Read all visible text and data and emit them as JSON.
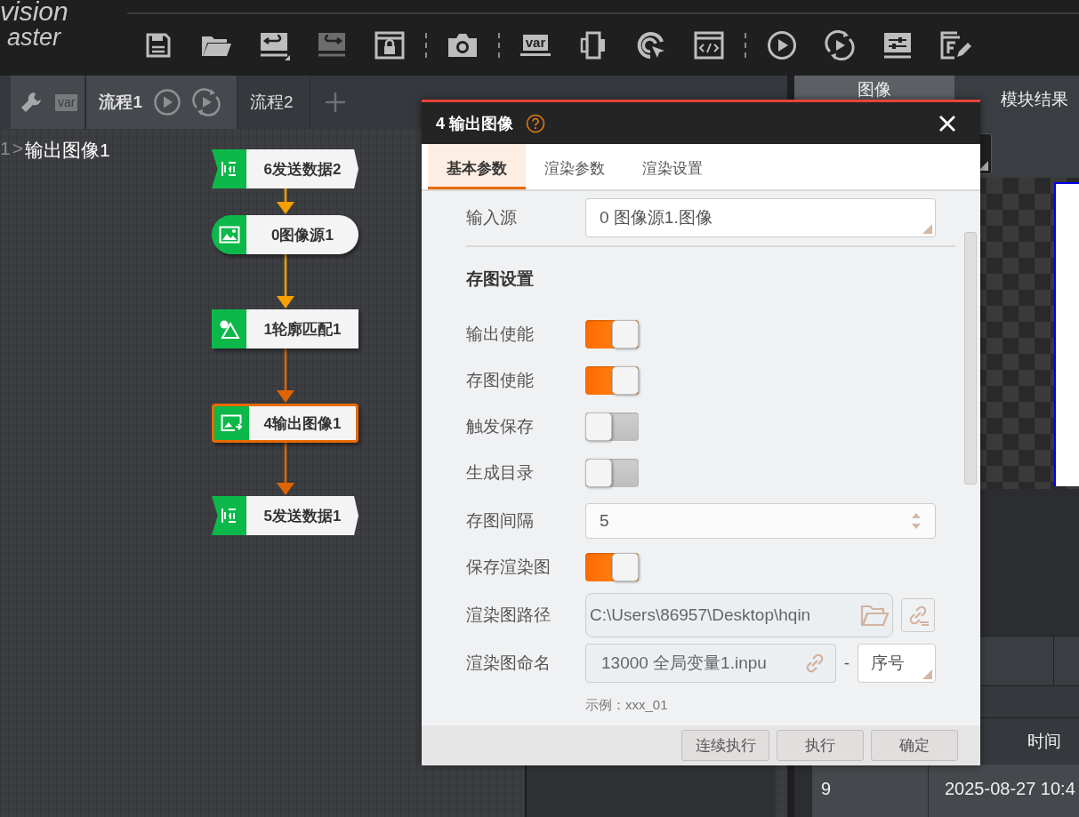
{
  "logo": {
    "line1": "vision",
    "line2": "aster"
  },
  "toolbar_groups": [
    [
      {
        "kind": "save",
        "disabled": false
      },
      {
        "kind": "open",
        "disabled": false
      },
      {
        "kind": "undo",
        "disabled": false
      },
      {
        "kind": "redo",
        "disabled": true
      },
      {
        "kind": "lock",
        "disabled": false
      }
    ],
    [
      {
        "kind": "camera",
        "disabled": false
      }
    ],
    [
      {
        "kind": "variable",
        "disabled": false,
        "text": "var"
      },
      {
        "kind": "device",
        "disabled": false
      },
      {
        "kind": "target",
        "disabled": false
      },
      {
        "kind": "code",
        "disabled": false
      }
    ],
    [
      {
        "kind": "run",
        "disabled": false
      },
      {
        "kind": "loop",
        "disabled": false
      },
      {
        "kind": "sliders",
        "disabled": false
      },
      {
        "kind": "formula",
        "disabled": false
      }
    ]
  ],
  "process_bar": {
    "var_badge": "var",
    "tabs": [
      {
        "label": "流程1",
        "selected": true
      },
      {
        "label": "流程2",
        "selected": false
      }
    ]
  },
  "breadcrumb": {
    "parent": "1",
    "separator": ">",
    "current": "输出图像1"
  },
  "nodes": [
    {
      "label": "6发送数据2",
      "kind": "send",
      "selected": false
    },
    {
      "label": "0图像源1",
      "kind": "source",
      "selected": false
    },
    {
      "label": "1轮廓匹配1",
      "kind": "match",
      "selected": false
    },
    {
      "label": "4输出图像1",
      "kind": "output",
      "selected": true
    },
    {
      "label": "5发送数据1",
      "kind": "send",
      "selected": false
    }
  ],
  "links": [
    {
      "color": "#f5a000"
    },
    {
      "color": "#f5a000"
    },
    {
      "color": "#e06400"
    },
    {
      "color": "#e06400"
    }
  ],
  "right_tabs": [
    {
      "label": "图像",
      "selected": true
    },
    {
      "label": "模块结果",
      "selected": false
    }
  ],
  "results_table": {
    "header": "时间",
    "rows": [
      {
        "index": "9",
        "time": "2025-08-27 10:4"
      }
    ]
  },
  "dialog": {
    "title": "4 输出图像",
    "tabs": [
      {
        "label": "基本参数",
        "selected": true
      },
      {
        "label": "渲染参数",
        "selected": false
      },
      {
        "label": "渲染设置",
        "selected": false
      }
    ],
    "rows": [
      {
        "kind": "select",
        "label": "输入源",
        "value": "0 图像源1.图像"
      },
      {
        "kind": "section",
        "label": "存图设置"
      },
      {
        "kind": "toggle",
        "label": "输出使能",
        "on": true
      },
      {
        "kind": "toggle",
        "label": "存图使能",
        "on": true
      },
      {
        "kind": "toggle",
        "label": "触发保存",
        "on": false
      },
      {
        "kind": "toggle",
        "label": "生成目录",
        "on": false
      },
      {
        "kind": "number",
        "label": "存图间隔",
        "value": "5"
      },
      {
        "kind": "toggle",
        "label": "保存渲染图",
        "on": true
      },
      {
        "kind": "path",
        "label": "渲染图路径",
        "value": "C:\\Users\\86957\\Desktop\\hqin"
      },
      {
        "kind": "naming",
        "label": "渲染图命名",
        "value": "13000 全局变量1.inpu",
        "joiner": "-",
        "suffix": "序号",
        "hint": "示例：xxx_01"
      }
    ],
    "buttons": [
      "连续执行",
      "执行",
      "确定"
    ]
  }
}
